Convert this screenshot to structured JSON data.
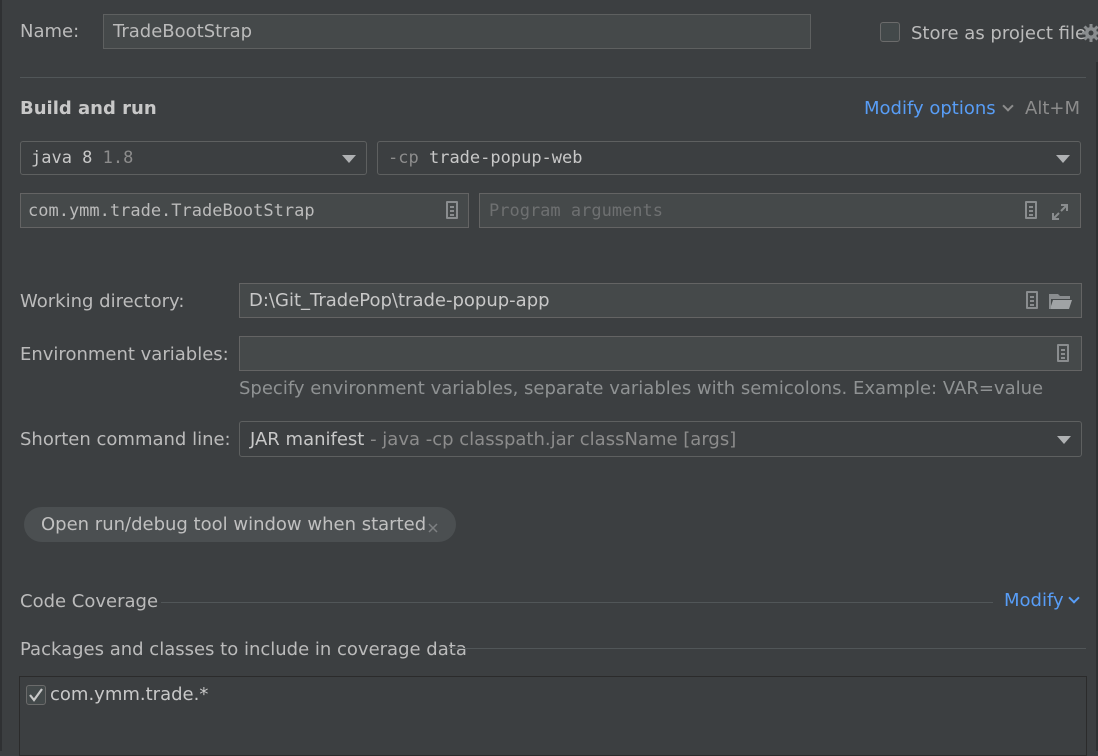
{
  "name": {
    "label": "Name:",
    "value": "TradeBootStrap"
  },
  "store_project_file": {
    "label": "Store as project file",
    "checked": false
  },
  "build_run": {
    "title": "Build and run",
    "modify_options": "Modify options",
    "shortcut": "Alt+M",
    "jre": {
      "name": "java 8",
      "version": "1.8"
    },
    "classpath": {
      "flag": "-cp",
      "module": "trade-popup-web"
    },
    "main_class": "com.ymm.trade.TradeBootStrap",
    "program_arguments_placeholder": "Program arguments"
  },
  "working_directory": {
    "label": "Working directory:",
    "value": "D:\\Git_TradePop\\trade-popup-app"
  },
  "env_vars": {
    "label": "Environment variables:",
    "value": "",
    "hint": "Specify environment variables, separate variables with semicolons. Example: VAR=value"
  },
  "shorten": {
    "label": "Shorten command line:",
    "value": "JAR manifest",
    "hint": "- java -cp classpath.jar className [args]"
  },
  "tool_window_chip": {
    "label": "Open run/debug tool window when started"
  },
  "coverage": {
    "title": "Code Coverage",
    "modify": "Modify",
    "packages_title": "Packages and classes to include in coverage data",
    "packages": [
      {
        "name": "com.ymm.trade.*",
        "checked": true
      }
    ]
  },
  "colors": {
    "background": "#3c3f41",
    "field": "#45494a",
    "link": "#589df6",
    "text": "#bbbbbb"
  }
}
